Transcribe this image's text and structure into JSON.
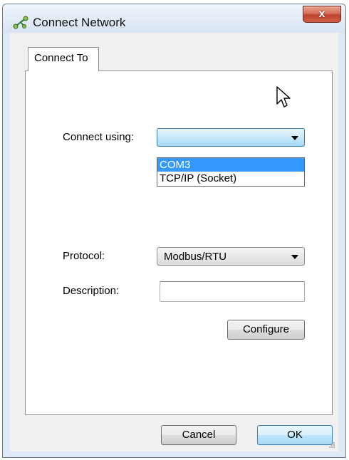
{
  "window": {
    "title": "Connect Network",
    "close_glyph": "x",
    "app_icon": "network-connect-icon"
  },
  "tabs": [
    {
      "label": "Connect To",
      "selected": true
    }
  ],
  "form": {
    "connect_using": {
      "label": "Connect using:",
      "value": "",
      "options": [
        "COM3",
        "TCP/IP (Socket)"
      ],
      "highlighted_option": "COM3"
    },
    "protocol": {
      "label": "Protocol:",
      "value": "Modbus/RTU"
    },
    "description": {
      "label": "Description:",
      "value": ""
    },
    "configure_button": "Configure"
  },
  "footer": {
    "cancel_button": "Cancel",
    "ok_button": "OK"
  },
  "colors": {
    "selection": "#3399ff",
    "close_button": "#c7472f",
    "focus_border": "#3c7fb1"
  }
}
